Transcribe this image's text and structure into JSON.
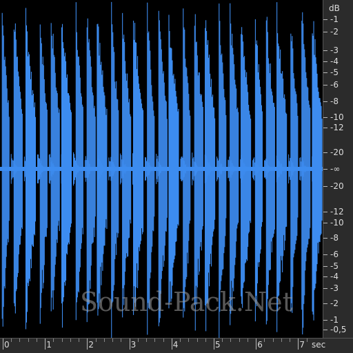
{
  "colors": {
    "waveform": "#3d8cf0",
    "background": "#000000",
    "ruler_bg": "#2b2b2b",
    "ruler_text": "#dcdcdc"
  },
  "watermark": "Sound-Pack.Net",
  "db_ruler": {
    "unit": "dB",
    "labels": [
      "-1",
      "-2",
      "-3",
      "-4",
      "-5",
      "-6",
      "-8",
      "-10",
      "-12",
      "-20",
      "-∞",
      "-20",
      "-12",
      "-10",
      "-8",
      "-6",
      "-5",
      "-4",
      "-3",
      "-2",
      "-1",
      "-0,5"
    ]
  },
  "time_ruler": {
    "unit": "sec",
    "labels": [
      "0",
      "1",
      "2",
      "3",
      "4",
      "5",
      "6",
      "7"
    ]
  },
  "waveform": {
    "duration_sec": 7.5,
    "hits_sec": [
      0.02,
      0.3,
      0.58,
      0.92,
      1.18,
      1.43,
      1.77,
      2.03,
      2.27,
      2.61,
      2.87,
      3.13,
      3.46,
      3.73,
      3.97,
      4.31,
      4.58,
      4.83,
      5.16,
      5.42,
      5.68,
      6.02,
      6.28,
      6.53,
      6.86,
      7.12,
      7.37
    ]
  }
}
